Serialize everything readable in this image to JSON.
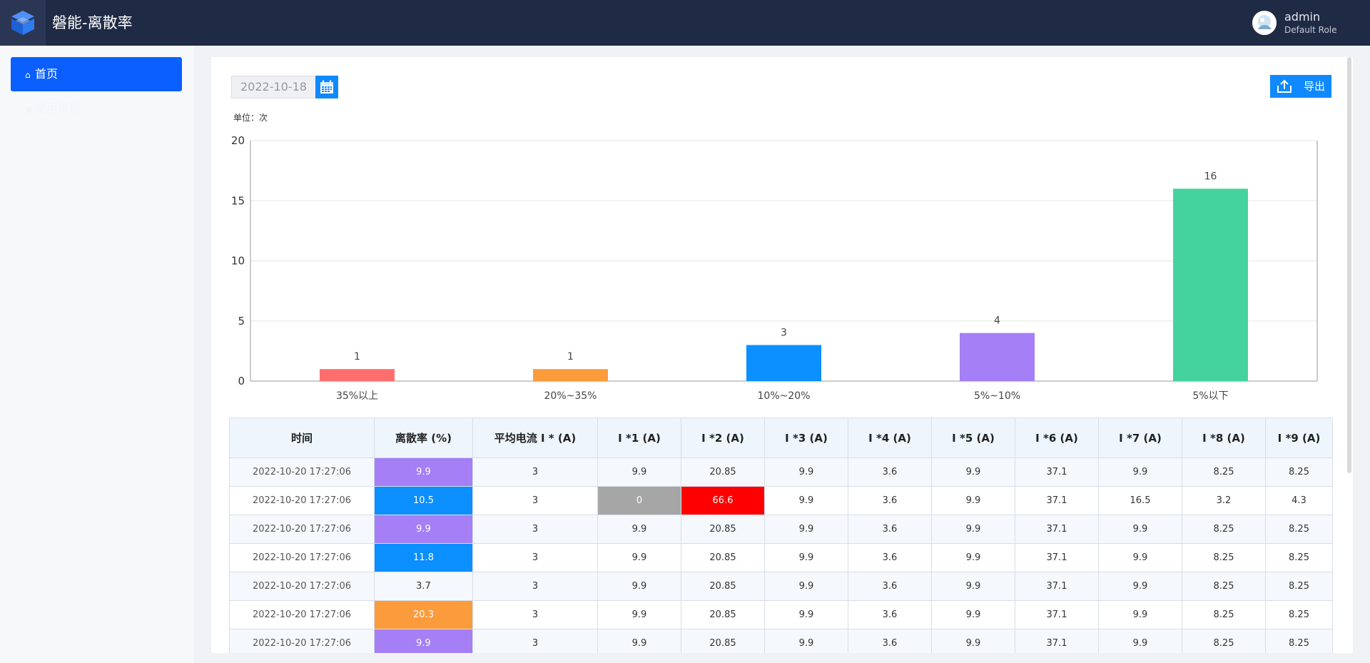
{
  "header": {
    "title": "磐能-离散率",
    "user_name": "admin",
    "user_role": "Default Role"
  },
  "sidebar": {
    "items": [
      {
        "label": "首页",
        "icon": "home-icon",
        "active": true
      },
      {
        "label": "使用帮助",
        "icon": "help-icon",
        "active": false
      }
    ]
  },
  "toolbar": {
    "date_value": "2022-10-18",
    "export_label": "导出"
  },
  "chart_data": {
    "type": "bar",
    "unit_label": "单位：次",
    "categories": [
      "35%以上",
      "20%~35%",
      "10%~20%",
      "5%~10%",
      "5%以下"
    ],
    "values": [
      1,
      1,
      3,
      4,
      16
    ],
    "colors": [
      "#ff6e6e",
      "#fc9b3c",
      "#0c8fff",
      "#a47ff5",
      "#44d39e"
    ],
    "ylim": [
      0,
      20
    ],
    "yticks": [
      0,
      5,
      10,
      15,
      20
    ],
    "grid": true
  },
  "table": {
    "headers": [
      "时间",
      "离散率 (%)",
      "平均电流 I * (A)",
      "I *1 (A)",
      "I *2 (A)",
      "I *3 (A)",
      "I *4 (A)",
      "I *5 (A)",
      "I *6 (A)",
      "I *7 (A)",
      "I *8 (A)",
      "I *9 (A)"
    ],
    "rows": [
      {
        "cells": [
          "2022-10-20 17:27:06",
          "9.9",
          "3",
          "9.9",
          "20.85",
          "9.9",
          "3.6",
          "9.9",
          "37.1",
          "9.9",
          "8.25",
          "8.25"
        ],
        "rate_color": "purple",
        "i1_color": "",
        "i2_color": ""
      },
      {
        "cells": [
          "2022-10-20 17:27:06",
          "10.5",
          "3",
          "0",
          "66.6",
          "9.9",
          "3.6",
          "9.9",
          "37.1",
          "16.5",
          "3.2",
          "4.3"
        ],
        "rate_color": "blue",
        "i1_color": "gray",
        "i2_color": "red"
      },
      {
        "cells": [
          "2022-10-20 17:27:06",
          "9.9",
          "3",
          "9.9",
          "20.85",
          "9.9",
          "3.6",
          "9.9",
          "37.1",
          "9.9",
          "8.25",
          "8.25"
        ],
        "rate_color": "purple",
        "i1_color": "",
        "i2_color": ""
      },
      {
        "cells": [
          "2022-10-20 17:27:06",
          "11.8",
          "3",
          "9.9",
          "20.85",
          "9.9",
          "3.6",
          "9.9",
          "37.1",
          "9.9",
          "8.25",
          "8.25"
        ],
        "rate_color": "blue",
        "i1_color": "",
        "i2_color": ""
      },
      {
        "cells": [
          "2022-10-20 17:27:06",
          "3.7",
          "3",
          "9.9",
          "20.85",
          "9.9",
          "3.6",
          "9.9",
          "37.1",
          "9.9",
          "8.25",
          "8.25"
        ],
        "rate_color": "",
        "i1_color": "",
        "i2_color": ""
      },
      {
        "cells": [
          "2022-10-20 17:27:06",
          "20.3",
          "3",
          "9.9",
          "20.85",
          "9.9",
          "3.6",
          "9.9",
          "37.1",
          "9.9",
          "8.25",
          "8.25"
        ],
        "rate_color": "orange",
        "i1_color": "",
        "i2_color": ""
      },
      {
        "cells": [
          "2022-10-20 17:27:06",
          "9.9",
          "3",
          "9.9",
          "20.85",
          "9.9",
          "3.6",
          "9.9",
          "37.1",
          "9.9",
          "8.25",
          "8.25"
        ],
        "rate_color": "purple",
        "i1_color": "",
        "i2_color": ""
      }
    ]
  }
}
